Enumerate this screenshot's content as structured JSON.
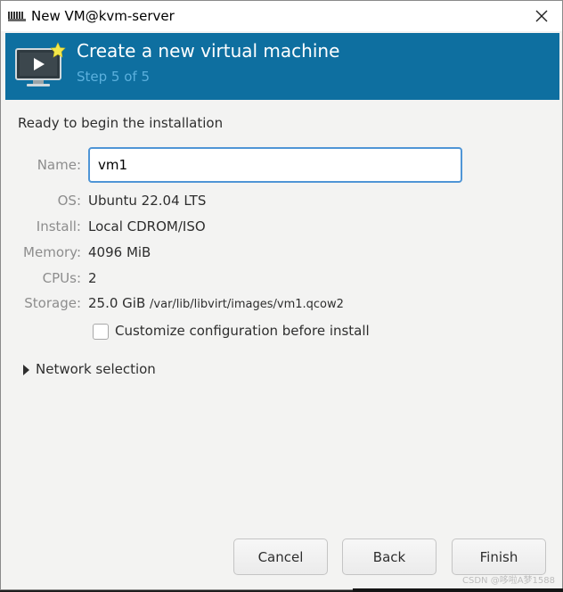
{
  "window": {
    "title": "New VM@kvm-server"
  },
  "banner": {
    "title": "Create a new virtual machine",
    "step": "Step 5 of 5"
  },
  "summary": {
    "heading": "Ready to begin the installation",
    "name_label": "Name:",
    "name_value": "vm1",
    "os_label": "OS:",
    "os_value": "Ubuntu 22.04 LTS",
    "install_label": "Install:",
    "install_value": "Local CDROM/ISO",
    "memory_label": "Memory:",
    "memory_value": "4096 MiB",
    "cpus_label": "CPUs:",
    "cpus_value": "2",
    "storage_label": "Storage:",
    "storage_size": "25.0 GiB",
    "storage_path": "/var/lib/libvirt/images/vm1.qcow2"
  },
  "customize": {
    "label": "Customize configuration before install",
    "checked": false
  },
  "network": {
    "label": "Network selection",
    "expanded": false
  },
  "buttons": {
    "cancel": "Cancel",
    "back": "Back",
    "finish": "Finish"
  },
  "watermark": "CSDN @哆啦A梦1588",
  "colors": {
    "banner_bg": "#0e6fa0",
    "banner_step": "#5bb0dd",
    "focus_border": "#4f95d6",
    "window_bg": "#f3f3f2"
  },
  "icons": {
    "app": "virt-manager-icon",
    "banner": "monitor-play-icon",
    "close": "close-icon",
    "expander": "triangle-right-icon"
  }
}
